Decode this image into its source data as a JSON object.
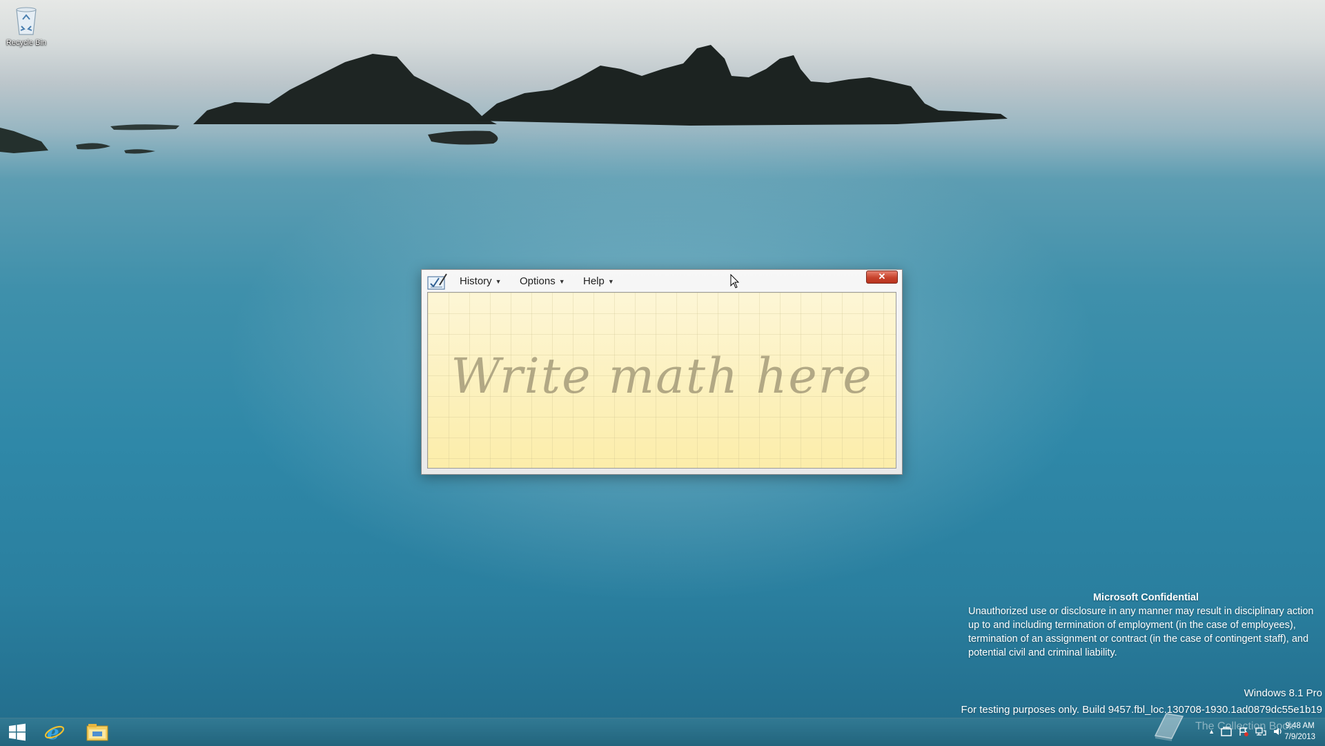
{
  "desktop": {
    "recycle_bin_label": "Recycle Bin"
  },
  "window": {
    "menus": [
      {
        "label": "History"
      },
      {
        "label": "Options"
      },
      {
        "label": "Help"
      }
    ],
    "close_label": "✕",
    "canvas_hint": "Write math here"
  },
  "watermark": {
    "title": "Microsoft Confidential",
    "body": "Unauthorized use or disclosure in any manner may result in disciplinary action up to and including termination of employment (in the case of employees), termination of an assignment or contract (in the case of contingent staff), and potential civil and criminal liability.",
    "edition": "Windows 8.1 Pro",
    "build": "For testing purposes only. Build 9457.fbl_loc.130708-1930.1ad0879dc55e1b19"
  },
  "taskbar": {
    "pinned": [
      "start-icon",
      "internet-explorer-icon",
      "file-explorer-icon"
    ],
    "overlay_text": "The Collection Book",
    "clock_time": "9:48 AM",
    "clock_date": "7/9/2013"
  },
  "colors": {
    "canvas": "#fdf3c4",
    "close": "#c7432c",
    "taskbar": "#1c6a88"
  }
}
